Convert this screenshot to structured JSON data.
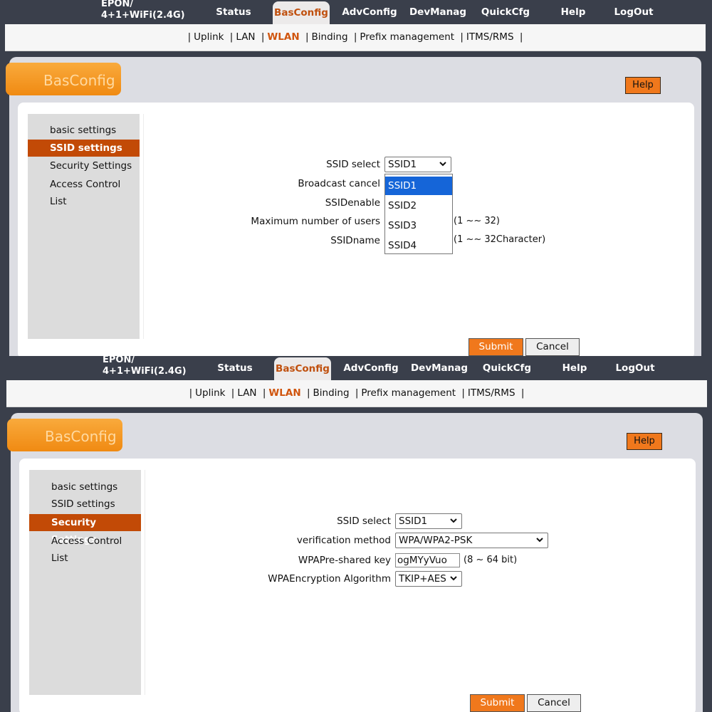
{
  "header": {
    "product_line1": "EPON/",
    "product_line2": "4+1+WiFi(2.4G)",
    "nav": [
      "Status",
      "BasConfig",
      "AdvConfig",
      "DevManag",
      "QuickCfg",
      "Help",
      "LogOut"
    ],
    "active_nav": "BasConfig"
  },
  "subnav": {
    "items": [
      "Uplink",
      "LAN",
      "WLAN",
      "Binding",
      "Prefix management",
      "ITMS/RMS"
    ],
    "active": "WLAN"
  },
  "page_title": "BasConfig",
  "help_label": "Help",
  "sidebar": {
    "items": [
      "basic settings",
      "SSID settings",
      "Security Settings",
      "Access Control List"
    ]
  },
  "ssid_panel": {
    "active_sidebar": "SSID settings",
    "labels": {
      "ssid_select": "SSID select",
      "broadcast_cancel": "Broadcast cancel",
      "ssid_enable": "SSIDenable",
      "max_users": "Maximum number of users",
      "ssid_name": "SSIDname"
    },
    "ssid_select_value": "SSID1",
    "dropdown_options": [
      "SSID1",
      "SSID2",
      "SSID3",
      "SSID4"
    ],
    "dropdown_highlighted": "SSID1",
    "max_users_hint": "(1 ~~ 32)",
    "ssid_name_hint": "(1 ~~ 32Character)"
  },
  "security_panel": {
    "active_sidebar": "Security Settings",
    "labels": {
      "ssid_select": "SSID select",
      "verification": "verification method",
      "psk": "WPAPre-shared key",
      "encryption": "WPAEncryption Algorithm"
    },
    "ssid_select_value": "SSID1",
    "verification_value": "WPA/WPA2-PSK",
    "psk_value": "ogMYyVuo",
    "psk_hint": "(8 ~ 64 bit)",
    "encryption_value": "TKIP+AES"
  },
  "buttons": {
    "submit": "Submit",
    "cancel": "Cancel"
  },
  "colors": {
    "topbar": "#3a3f4b",
    "accent": "#f0781c",
    "sidebar_active": "#c24a06",
    "link_active": "#d0550e",
    "dropdown_highlight": "#1565d8"
  }
}
